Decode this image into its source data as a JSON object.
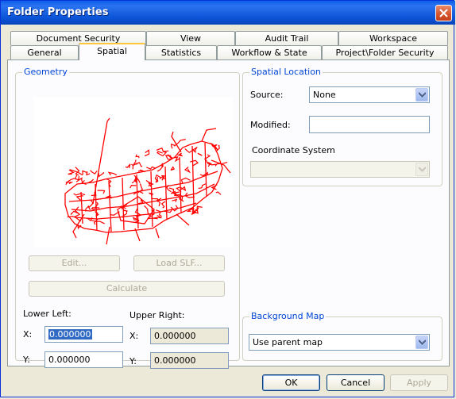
{
  "window": {
    "title": "Folder Properties"
  },
  "tabs_row1": [
    "Document Security",
    "View",
    "Audit Trail",
    "Workspace"
  ],
  "tabs_row2": [
    "General",
    "Spatial",
    "Statistics",
    "Workflow & State",
    "Project\\Folder Security"
  ],
  "active_tab": "Spatial",
  "geometry": {
    "legend": "Geometry",
    "edit_label": "Edit...",
    "load_slf_label": "Load SLF...",
    "calculate_label": "Calculate",
    "lower_left_label": "Lower Left:",
    "upper_right_label": "Upper Right:",
    "x_label": "X:",
    "y_label": "Y:",
    "lower_left_x": "0.000000",
    "lower_left_y": "0.000000",
    "upper_right_x": "0.000000",
    "upper_right_y": "0.000000",
    "map_color": "#ff0000"
  },
  "spatial_location": {
    "legend": "Spatial Location",
    "source_label": "Source:",
    "source_value": "None",
    "modified_label": "Modified:",
    "modified_value": "",
    "coordinate_system_label": "Coordinate System",
    "coordinate_system_value": ""
  },
  "background_map": {
    "legend": "Background Map",
    "value": "Use parent map"
  },
  "footer": {
    "ok": "OK",
    "cancel": "Cancel",
    "apply": "Apply"
  }
}
